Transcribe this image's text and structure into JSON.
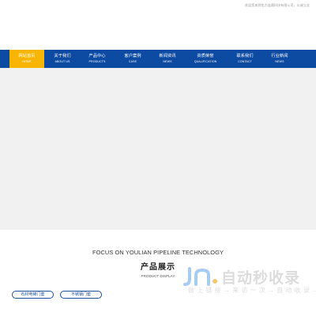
{
  "topbar": {
    "text": "欢迎您来到佑力连通科技有限公司，以诚立业"
  },
  "nav": {
    "items": [
      {
        "label": "网站首页",
        "sub": "HOME"
      },
      {
        "label": "关于我们",
        "sub": "ABOUT US"
      },
      {
        "label": "产品中心",
        "sub": "PRODUCTS"
      },
      {
        "label": "客户案例",
        "sub": "CASE"
      },
      {
        "label": "新闻资讯",
        "sub": "NEWS"
      },
      {
        "label": "资质荣誉",
        "sub": "QUALIFICATION"
      },
      {
        "label": "联系我们",
        "sub": "CONTACT"
      },
      {
        "label": "行业新闻",
        "sub": "NEWS"
      }
    ],
    "active_index": 0
  },
  "section": {
    "title_en": "FOCUS ON YOULIAN PIPELINE TECHNOLOGY",
    "title_cn": "产品展示",
    "subtitle": "PRODUCT DISPLAY"
  },
  "categories": [
    {
      "label": "石材电梯门套"
    },
    {
      "label": "不锈钢门套"
    }
  ],
  "watermark": {
    "main": "自动秒收录",
    "sub": "做 上 链 接 → 来 访 一 次 → 自 动 收 录 →"
  },
  "colors": {
    "nav_bg": "#0d4aa2",
    "nav_active": "#f7b500",
    "accent": "#1d4e9a"
  }
}
